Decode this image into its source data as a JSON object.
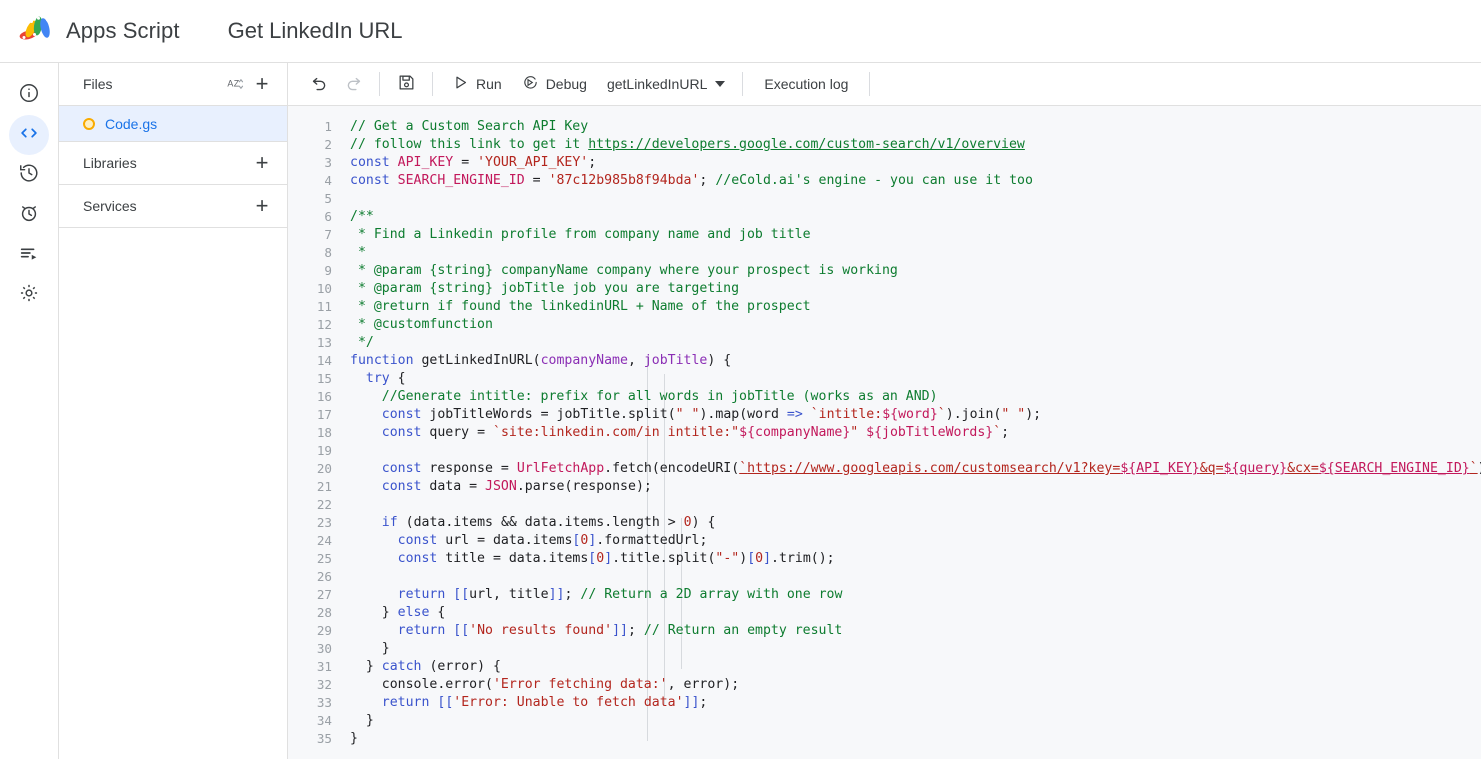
{
  "header": {
    "brand": "Apps Script",
    "logo_icon": "apps-script-logo",
    "doc_title": "Get LinkedIn URL"
  },
  "rail": {
    "items": [
      {
        "icon": "info-circle-icon",
        "name": "overview",
        "active": false
      },
      {
        "icon": "code-brackets-icon",
        "name": "editor",
        "active": true
      },
      {
        "icon": "history-clock-icon",
        "name": "triggers-history",
        "active": false
      },
      {
        "icon": "alarm-clock-icon",
        "name": "triggers",
        "active": false
      },
      {
        "icon": "executions-list-icon",
        "name": "executions",
        "active": false
      },
      {
        "icon": "gear-icon",
        "name": "project-settings",
        "active": false
      }
    ]
  },
  "file_panel": {
    "files_label": "Files",
    "sort_icon": "sort-az-icon",
    "add_icon": "plus-icon",
    "file": {
      "name": "Code.gs",
      "status_icon": "orange-circle-icon"
    },
    "libraries_label": "Libraries",
    "services_label": "Services"
  },
  "toolbar": {
    "undo_icon": "undo-icon",
    "redo_icon": "redo-icon",
    "save_icon": "save-icon",
    "run_icon": "play-icon",
    "run_label": "Run",
    "debug_icon": "debug-icon",
    "debug_label": "Debug",
    "function_select": "getLinkedInURL",
    "caret_icon": "chevron-down-icon",
    "execution_log_label": "Execution log"
  },
  "editor": {
    "language": "javascript",
    "lines": [
      {
        "n": 1,
        "text": "// Get a Custom Search API Key"
      },
      {
        "n": 2,
        "text": "// follow this link to get it https://developers.google.com/custom-search/v1/overview"
      },
      {
        "n": 3,
        "text": "const API_KEY = 'YOUR_API_KEY';"
      },
      {
        "n": 4,
        "text": "const SEARCH_ENGINE_ID = '87c12b985b8f94bda'; //eCold.ai's engine - you can use it too"
      },
      {
        "n": 5,
        "text": ""
      },
      {
        "n": 6,
        "text": "/**"
      },
      {
        "n": 7,
        "text": " * Find a Linkedin profile from company name and job title"
      },
      {
        "n": 8,
        "text": " *"
      },
      {
        "n": 9,
        "text": " * @param {string} companyName company where your prospect is working"
      },
      {
        "n": 10,
        "text": " * @param {string} jobTitle job you are targeting"
      },
      {
        "n": 11,
        "text": " * @return if found the linkedinURL + Name of the prospect"
      },
      {
        "n": 12,
        "text": " * @customfunction"
      },
      {
        "n": 13,
        "text": " */"
      },
      {
        "n": 14,
        "text": "function getLinkedInURL(companyName, jobTitle) {"
      },
      {
        "n": 15,
        "text": "  try {"
      },
      {
        "n": 16,
        "text": "    //Generate intitle: prefix for all words in jobTitle (works as an AND)"
      },
      {
        "n": 17,
        "text": "    const jobTitleWords = jobTitle.split(\" \").map(word => `intitle:${word}`).join(\" \");"
      },
      {
        "n": 18,
        "text": "    const query = `site:linkedin.com/in intitle:\"${companyName}\" ${jobTitleWords}`;"
      },
      {
        "n": 19,
        "text": ""
      },
      {
        "n": 20,
        "text": "    const response = UrlFetchApp.fetch(encodeURI(`https://www.googleapis.com/customsearch/v1?key=${API_KEY}&q=${query}&cx=${SEARCH_ENGINE_ID}`));"
      },
      {
        "n": 21,
        "text": "    const data = JSON.parse(response);"
      },
      {
        "n": 22,
        "text": ""
      },
      {
        "n": 23,
        "text": "    if (data.items && data.items.length > 0) {"
      },
      {
        "n": 24,
        "text": "      const url = data.items[0].formattedUrl;"
      },
      {
        "n": 25,
        "text": "      const title = data.items[0].title.split(\"-\")[0].trim();"
      },
      {
        "n": 26,
        "text": ""
      },
      {
        "n": 27,
        "text": "      return [[url, title]]; // Return a 2D array with one row"
      },
      {
        "n": 28,
        "text": "    } else {"
      },
      {
        "n": 29,
        "text": "      return [['No results found']]; // Return an empty result"
      },
      {
        "n": 30,
        "text": "    }"
      },
      {
        "n": 31,
        "text": "  } catch (error) {"
      },
      {
        "n": 32,
        "text": "    console.error('Error fetching data:', error);"
      },
      {
        "n": 33,
        "text": "    return [['Error: Unable to fetch data']];"
      },
      {
        "n": 34,
        "text": "  }"
      },
      {
        "n": 35,
        "text": "}"
      }
    ]
  },
  "colors": {
    "accent_blue": "#1a73e8",
    "selection_blue": "#e8f0fe",
    "comment_green": "#0d7c2f",
    "keyword_blue": "#3a53cc",
    "identifier_pink": "#c2185b",
    "string_red": "#b3261e",
    "editor_bg": "#f7f8fa",
    "file_status_orange": "#f9ab00"
  }
}
